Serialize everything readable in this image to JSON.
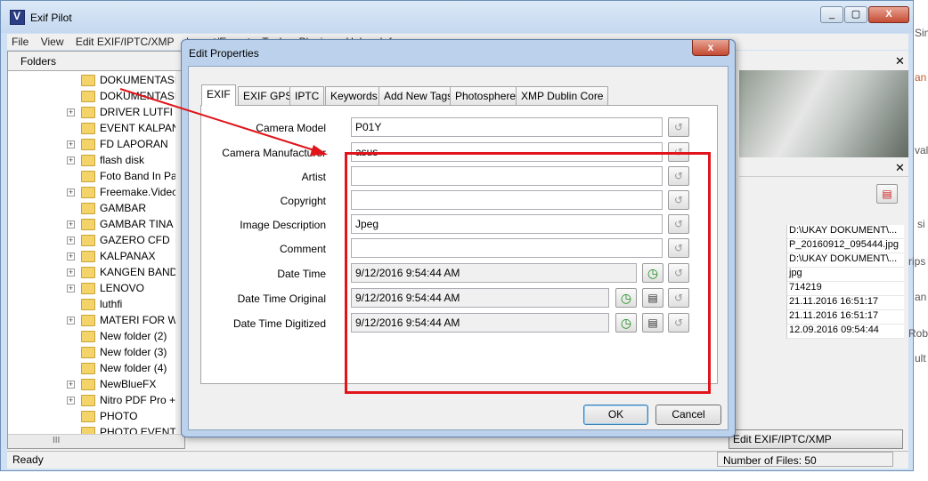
{
  "app": {
    "title": "Exif Pilot",
    "window_buttons": [
      "_",
      "▢",
      "X"
    ]
  },
  "menu": [
    "File",
    "View",
    "Edit EXIF/IPTC/XMP",
    "Import/Export",
    "Tools",
    "Plugins",
    "Help",
    "Info"
  ],
  "folders": {
    "title": "Folders",
    "close": "✕",
    "items": [
      {
        "label": "DOKUMENTASI",
        "exp": false
      },
      {
        "label": "DOKUMENTASI",
        "exp": false
      },
      {
        "label": "DRIVER LUTFI",
        "exp": true
      },
      {
        "label": "EVENT KALPAN",
        "exp": false
      },
      {
        "label": "FD LAPORAN",
        "exp": true
      },
      {
        "label": "flash disk",
        "exp": true
      },
      {
        "label": "Foto Band In Pa",
        "exp": false
      },
      {
        "label": "Freemake.Videc",
        "exp": true
      },
      {
        "label": "GAMBAR",
        "exp": false
      },
      {
        "label": "GAMBAR TINA",
        "exp": true
      },
      {
        "label": "GAZERO CFD",
        "exp": true
      },
      {
        "label": "KALPANAX",
        "exp": true
      },
      {
        "label": "KANGEN BAND",
        "exp": true
      },
      {
        "label": "LENOVO",
        "exp": true
      },
      {
        "label": "luthfi",
        "exp": false
      },
      {
        "label": "MATERI FOR W",
        "exp": true
      },
      {
        "label": "New folder (2)",
        "exp": false
      },
      {
        "label": "New folder (3)",
        "exp": false
      },
      {
        "label": "New folder (4)",
        "exp": false
      },
      {
        "label": "NewBlueFX",
        "exp": true
      },
      {
        "label": "Nitro PDF Pro +",
        "exp": true
      },
      {
        "label": "PHOTO",
        "exp": false
      },
      {
        "label": "PHOTO EVENT",
        "exp": false
      }
    ],
    "scroll_glyph": "III"
  },
  "right": {
    "close1": "✕",
    "close2": "✕",
    "list": [
      "D:\\UKAY DOKUMENT\\...",
      "P_20160912_095444.jpg",
      "D:\\UKAY DOKUMENT\\...",
      "jpg",
      "714219",
      "21.11.2016 16:51:17",
      "21.11.2016 16:51:17",
      "12.09.2016 09:54:44"
    ],
    "edit_button": "Edit EXIF/IPTC/XMP",
    "edge_labels": [
      "Sim",
      "an",
      "val",
      "si",
      "rips",
      "an",
      "Rob",
      "ult"
    ]
  },
  "status": {
    "ready": "Ready",
    "files": "Number of Files: 50"
  },
  "dialog": {
    "title": "Edit Properties",
    "close": "x",
    "tabs": [
      "EXIF",
      "EXIF GPS",
      "IPTC",
      "Keywords",
      "Add New Tags",
      "Photosphere",
      "XMP Dublin Core"
    ],
    "active_tab": "EXIF",
    "fields": [
      {
        "label": "Camera Model",
        "value": "P01Y"
      },
      {
        "label": "Camera Manufacturer",
        "value": "asus"
      },
      {
        "label": "Artist",
        "value": ""
      },
      {
        "label": "Copyright",
        "value": ""
      },
      {
        "label": "Image Description",
        "value": "Jpeg"
      },
      {
        "label": "Comment",
        "value": ""
      },
      {
        "label": "Date Time",
        "value": "9/12/2016 9:54:44 AM"
      },
      {
        "label": "Date Time Original",
        "value": "9/12/2016 9:54:44 AM"
      },
      {
        "label": "Date Time Digitized",
        "value": "9/12/2016 9:54:44 AM"
      }
    ],
    "ok": "OK",
    "cancel": "Cancel"
  },
  "icons": {
    "revert": "revert-icon",
    "clock": "clock-icon",
    "copy": "copy-icon",
    "folder": "folder-icon"
  },
  "colors": {
    "highlight": "#e0141a",
    "title_bar": "#c4d8ef"
  }
}
